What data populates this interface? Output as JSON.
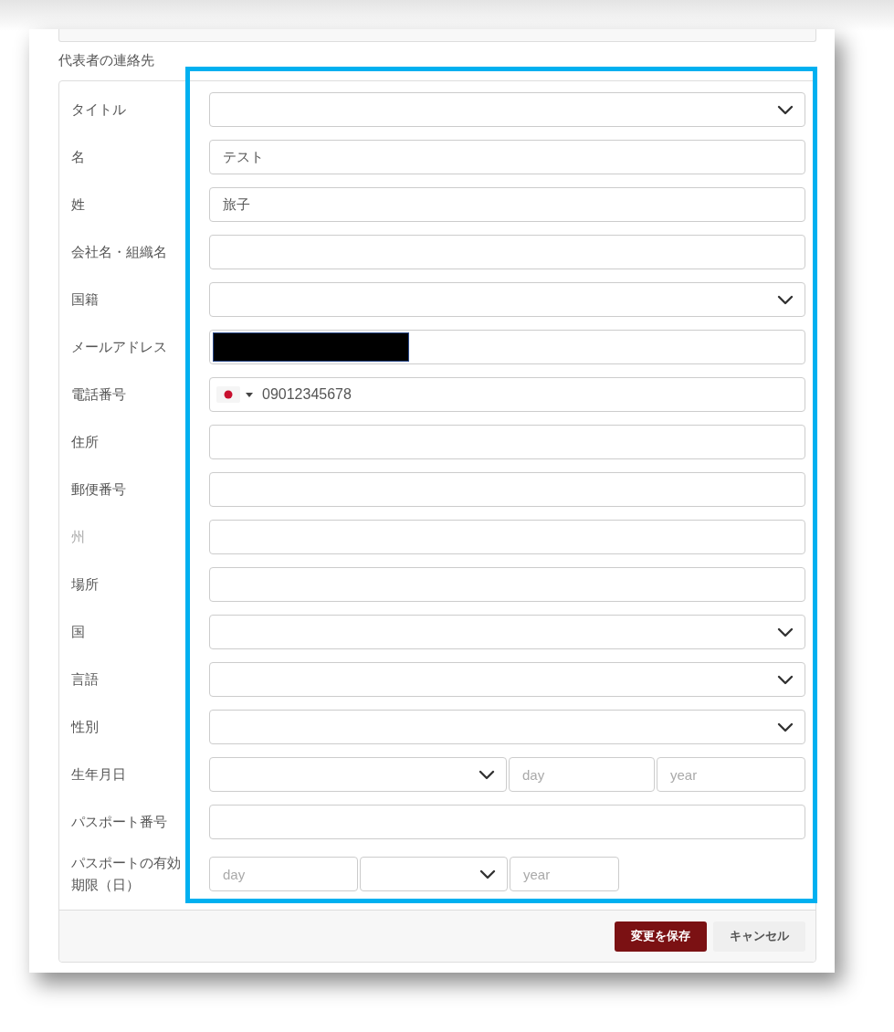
{
  "section": {
    "heading": "代表者の連絡先"
  },
  "fields": [
    {
      "label": "タイトル",
      "kind": "select",
      "disabled": false
    },
    {
      "label": "名",
      "kind": "text",
      "value": "テスト",
      "disabled": false
    },
    {
      "label": "姓",
      "kind": "text",
      "value": "旅子",
      "disabled": false
    },
    {
      "label": "会社名・組織名",
      "kind": "text",
      "disabled": false
    },
    {
      "label": "国籍",
      "kind": "select",
      "disabled": false
    },
    {
      "label": "メールアドレス",
      "kind": "redacted",
      "disabled": false
    },
    {
      "label": "電話番号",
      "kind": "phone",
      "value": "09012345678",
      "disabled": false
    },
    {
      "label": "住所",
      "kind": "text",
      "disabled": false
    },
    {
      "label": "郵便番号",
      "kind": "text",
      "disabled": false
    },
    {
      "label": "州",
      "kind": "text",
      "disabled": true
    },
    {
      "label": "場所",
      "kind": "text",
      "disabled": false
    },
    {
      "label": "国",
      "kind": "select",
      "disabled": false
    },
    {
      "label": "言語",
      "kind": "select",
      "disabled": false
    },
    {
      "label": "性別",
      "kind": "select",
      "disabled": false
    },
    {
      "label": "生年月日",
      "kind": "date",
      "disabled": false,
      "parts": [
        {
          "kind": "select"
        },
        {
          "kind": "text",
          "placeholder": "day"
        },
        {
          "kind": "text",
          "placeholder": "year"
        }
      ]
    },
    {
      "label": "パスポート番号",
      "kind": "text",
      "disabled": false
    },
    {
      "label": "パスポートの有効期限（日）",
      "kind": "date",
      "disabled": false,
      "parts": [
        {
          "kind": "text",
          "placeholder": "day"
        },
        {
          "kind": "select"
        },
        {
          "kind": "text",
          "placeholder": "year"
        }
      ]
    }
  ],
  "buttons": [
    {
      "label": "変更を保存",
      "kind": "primary"
    },
    {
      "label": "キャンセル",
      "kind": "secondary"
    }
  ]
}
